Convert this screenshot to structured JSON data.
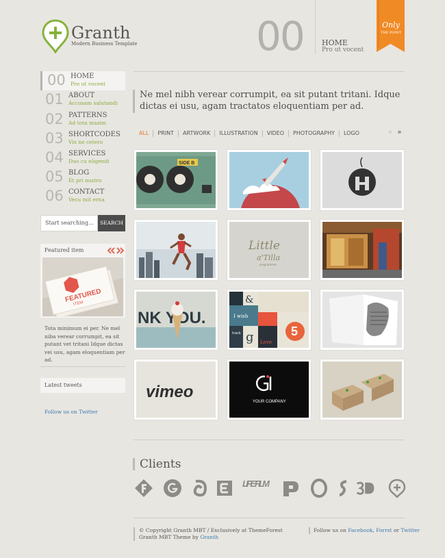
{
  "logo": {
    "title": "Granth",
    "tagline": "Modern Business Template"
  },
  "page_header": {
    "number": "00",
    "title": "HOME",
    "subtitle": "Pro ut vocent"
  },
  "ribbon": {
    "line1": "Only",
    "line2": "THE POINT"
  },
  "nav": [
    {
      "num": "00",
      "label": "HOME",
      "sub": "Pro ut vocent",
      "active": true
    },
    {
      "num": "01",
      "label": "ABOUT",
      "sub": "Accusam salutandi"
    },
    {
      "num": "02",
      "label": "PATTERNS",
      "sub": "Ad tota mazim"
    },
    {
      "num": "03",
      "label": "SHORTCODES",
      "sub": "Vix ne cetero"
    },
    {
      "num": "04",
      "label": "SERVICES",
      "sub": "Duo cu eligendi"
    },
    {
      "num": "05",
      "label": "BLOG",
      "sub": "Et pri nostro"
    },
    {
      "num": "06",
      "label": "CONTACT",
      "sub": "Vecu mit erna"
    }
  ],
  "search": {
    "placeholder": "Start searching...",
    "button": "SEARCH"
  },
  "featured": {
    "title": "Featured item",
    "card_line1": "FEATURED",
    "card_line2": "ITEM",
    "text": "Tota minimum ei per. Ne mel niba verear corrumpit, ea sit putant vet tritani Idque dictas vei usu, agam eloquentiam per ad."
  },
  "tweets": {
    "title": "Latest tweets",
    "follow": "Follow us on Twitter"
  },
  "intro": "Ne mel nibh verear corrumpit, ea sit putant tritani. Idque dictas ei usu, agam tractatos eloquentiam per ad.",
  "filters": [
    "ALL",
    "PRINT",
    "ARTWORK",
    "ILLUSTRATION",
    "VIDEO",
    "PHOTOGRAPHY",
    "LOGO"
  ],
  "pager": {
    "prev": "«",
    "next": "»"
  },
  "portfolio": [
    {
      "name": "cassette",
      "label": "SIDE B"
    },
    {
      "name": "rocket"
    },
    {
      "name": "tag-logo"
    },
    {
      "name": "runner"
    },
    {
      "name": "little-atilla",
      "label1": "Little",
      "label2": "a'Tilla",
      "label3": "programmer"
    },
    {
      "name": "storefront"
    },
    {
      "name": "thank-you",
      "label": "NK YOU."
    },
    {
      "name": "typography-grid",
      "label1": "&",
      "label2": "I wish",
      "label3": "5",
      "label4": "g",
      "label5": "Love",
      "label6": "track"
    },
    {
      "name": "book"
    },
    {
      "name": "vimeo",
      "label": "vimeo"
    },
    {
      "name": "your-company",
      "label": "YOUR COMPANY"
    },
    {
      "name": "boxes"
    }
  ],
  "clients": {
    "title": "Clients",
    "logos": [
      "f-logo",
      "g-logo",
      "swirl-logo",
      "e-logo",
      "lifefilm-logo",
      "p-logo",
      "o-logo",
      "s-logo",
      "3d-logo",
      "plus-pin-logo"
    ],
    "lifefilm_text": "LIFE FILM"
  },
  "footer": {
    "copyright": "© Copyright Granth MBT / Exclusively at ThemeForest",
    "credit_prefix": "Granth MBT Theme by",
    "credit_link": "Granth",
    "follow_prefix": "Follow us on",
    "facebook": "Facebook",
    "sep1": ",",
    "forrst": "Forrst",
    "or": "or",
    "twitter": "Twitter"
  },
  "colors": {
    "accent_green": "#8bab3e",
    "accent_orange": "#f08a24",
    "link_blue": "#3a7ab0"
  }
}
